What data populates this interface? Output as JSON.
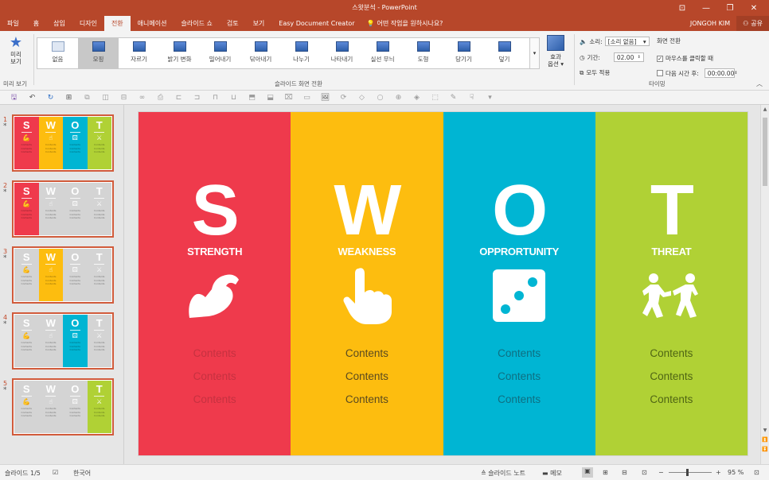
{
  "window": {
    "title": "스왓분석 - PowerPoint",
    "controls": [
      "⊡",
      "—",
      "❐",
      "✕"
    ]
  },
  "tabs": [
    {
      "label": "파일"
    },
    {
      "label": "홈"
    },
    {
      "label": "삽입"
    },
    {
      "label": "디자인"
    },
    {
      "label": "전환",
      "active": true
    },
    {
      "label": "애니메이션"
    },
    {
      "label": "슬라이드 쇼"
    },
    {
      "label": "검토"
    },
    {
      "label": "보기"
    },
    {
      "label": "Easy Document Creator"
    }
  ],
  "tell_me": "어떤 작업을 원하시나요?",
  "user": "JONGOH KIM",
  "share": "공유",
  "ribbon": {
    "preview_label_1": "미리",
    "preview_label_2": "보기",
    "preview_group": "미리 보기",
    "transitions_group": "슬라이드 화면 전환",
    "transitions": [
      "없음",
      "모핑",
      "자르기",
      "밝기 변화",
      "밀어내기",
      "닦아내기",
      "나누기",
      "나타내기",
      "실선 무늬",
      "도형",
      "당기기",
      "덮기"
    ],
    "selected_transition": "모핑",
    "effect_options_1": "효과",
    "effect_options_2": "옵션 ▾",
    "timing_group": "타이밍",
    "sound_label": "소리:",
    "sound_value": "[소리 없음]",
    "duration_label": "기간:",
    "duration_value": "02.00",
    "apply_all": "모두 적용",
    "advance_label": "화면 전환",
    "on_click_label": "마우스를 클릭할 때",
    "after_label": "다음 시간 후:",
    "after_value": "00:00.00"
  },
  "slide": {
    "columns": [
      {
        "letter": "S",
        "word": "STRENGTH",
        "color": "#ef3a4c",
        "icon": "flexed-arm-icon",
        "contents": [
          "Contents",
          "Contents",
          "Contents"
        ],
        "contents_color": "#c63140"
      },
      {
        "letter": "W",
        "word": "WEAKNESS",
        "color": "#fdbd0f",
        "icon": "pointing-hand-icon",
        "contents": [
          "Contents",
          "Contents",
          "Contents"
        ],
        "contents_color": "#5a4a20"
      },
      {
        "letter": "O",
        "word": "OPPRORTUNITY",
        "color": "#00b5d3",
        "icon": "dice-icon",
        "contents": [
          "Contents",
          "Contents",
          "Contents"
        ],
        "contents_color": "#0e6f82"
      },
      {
        "letter": "T",
        "word": "THREAT",
        "color": "#b0d135",
        "icon": "fighting-people-icon",
        "contents": [
          "Contents",
          "Contents",
          "Contents"
        ],
        "contents_color": "#4f6514"
      }
    ]
  },
  "thumbnails": [
    {
      "num": "1",
      "active_col": -1
    },
    {
      "num": "2",
      "active_col": 0
    },
    {
      "num": "3",
      "active_col": 1
    },
    {
      "num": "4",
      "active_col": 2
    },
    {
      "num": "5",
      "active_col": 3
    }
  ],
  "status": {
    "slide_count": "슬라이드 1/5",
    "language": "한국어",
    "notes": "슬라이드 노트",
    "comments": "메모",
    "zoom": "95 %"
  }
}
